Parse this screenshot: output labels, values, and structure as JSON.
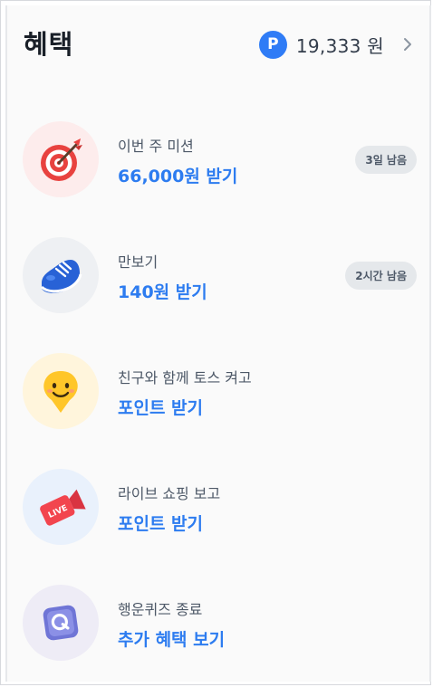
{
  "header": {
    "title": "혜택",
    "points_badge": "P",
    "points_value": "19,333 원"
  },
  "items": [
    {
      "label": "이번 주 미션",
      "action": "66,000원 받기",
      "badge": "3일 남음",
      "icon": "target-dart-icon"
    },
    {
      "label": "만보기",
      "action": "140원 받기",
      "badge": "2시간 남음",
      "icon": "sneaker-icon"
    },
    {
      "label": "친구와 함께 토스 켜고",
      "action": "포인트 받기",
      "badge": "",
      "icon": "smiley-pin-icon"
    },
    {
      "label": "라이브 쇼핑 보고",
      "action": "포인트 받기",
      "badge": "",
      "icon": "live-camera-icon"
    },
    {
      "label": "행운퀴즈 종료",
      "action": "추가 혜택 보기",
      "badge": "",
      "icon": "quiz-box-icon"
    }
  ],
  "colors": {
    "accent": "#2d7cf0",
    "points_badge": "#2f7cf6",
    "badge_bg": "#e5e8eb"
  }
}
